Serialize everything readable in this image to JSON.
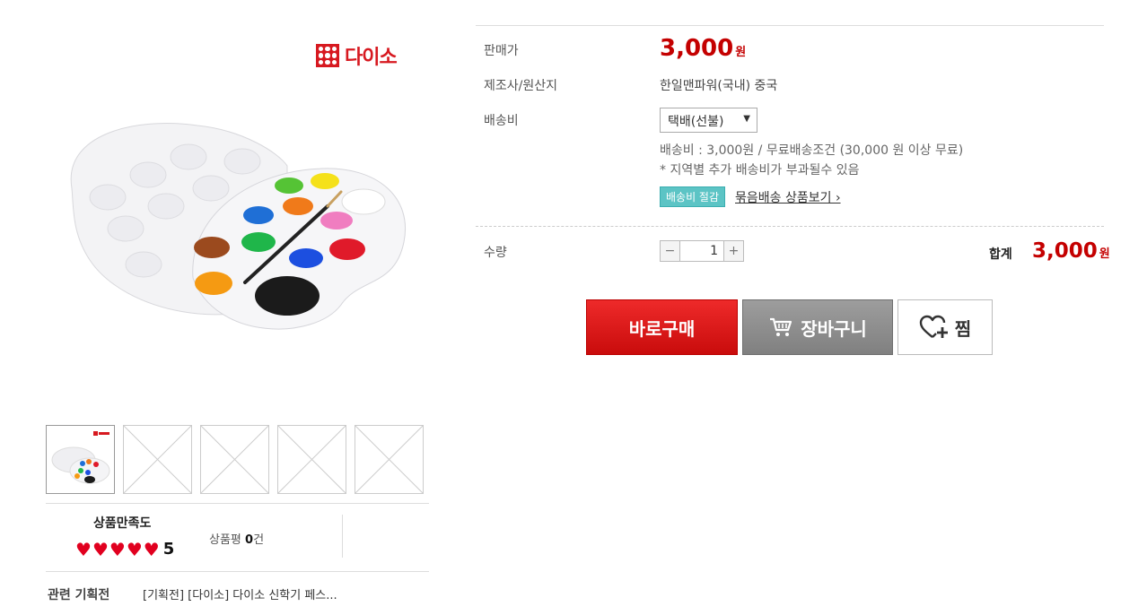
{
  "brand": {
    "logo_text": "다이소"
  },
  "product": {
    "price_label": "판매가",
    "price": "3,000",
    "price_unit": "원",
    "maker_label": "제조사/원산지",
    "maker": "한일맨파워(국내) 중국",
    "shipping_label": "배송비",
    "shipping_option": "택배(선불)",
    "shipping_info_line1": "배송비 : 3,000원 / 무료배송조건 (30,000 원 이상 무료)",
    "shipping_info_line2": "* 지역별 추가 배송비가 부과될수 있음",
    "shipping_badge": "배송비 절감",
    "bundle_link": "묶음배송 상품보기 ›",
    "quantity_label": "수량",
    "quantity_minus": "−",
    "quantity": "1",
    "quantity_plus": "+",
    "total_label": "합계",
    "total": "3,000",
    "total_unit": "원"
  },
  "buttons": {
    "buy": "바로구매",
    "cart": "장바구니",
    "wish": "찜"
  },
  "review": {
    "satisfaction_title": "상품만족도",
    "score": "5",
    "review_label": "상품평",
    "review_count": "0",
    "review_unit": "건"
  },
  "related": {
    "label": "관련 기획전",
    "value": "[기획전] [다이소] 다이소 신학기 페스..."
  },
  "colors": {
    "accent_red": "#c40000",
    "badge_teal": "#5cc4c5"
  },
  "icons": [
    "daiso-logo-icon",
    "cart-icon",
    "heart-plus-icon",
    "heart-icon",
    "chevron-down-icon"
  ]
}
